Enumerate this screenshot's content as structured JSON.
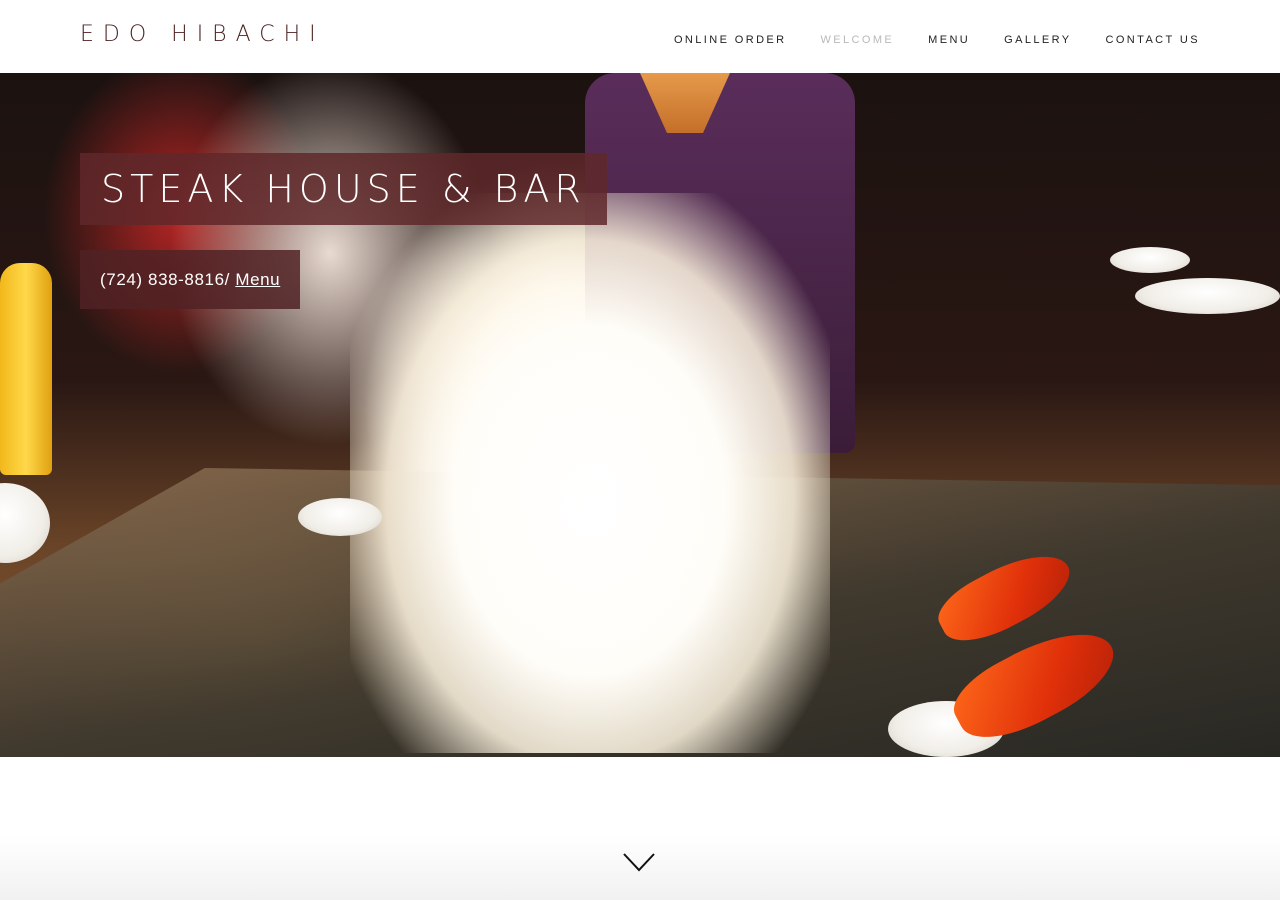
{
  "header": {
    "logo": "EDO HIBACHI",
    "nav": [
      {
        "label": "ONLINE ORDER",
        "active": false
      },
      {
        "label": "WELCOME",
        "active": true
      },
      {
        "label": "MENU",
        "active": false
      },
      {
        "label": "GALLERY",
        "active": false
      },
      {
        "label": "CONTACT US",
        "active": false
      }
    ]
  },
  "hero": {
    "title": "STEAK HOUSE & BAR",
    "phone": "(724) 838-8816/",
    "menu_link": "Menu",
    "image": "hibachi-chef-flame-photo"
  },
  "scroll": {
    "icon": "chevron-down-icon"
  },
  "colors": {
    "logo": "#4a1f1f",
    "nav_active": "#b9b9b9",
    "title_box": "#5f282a",
    "phone_box": "#502224"
  }
}
